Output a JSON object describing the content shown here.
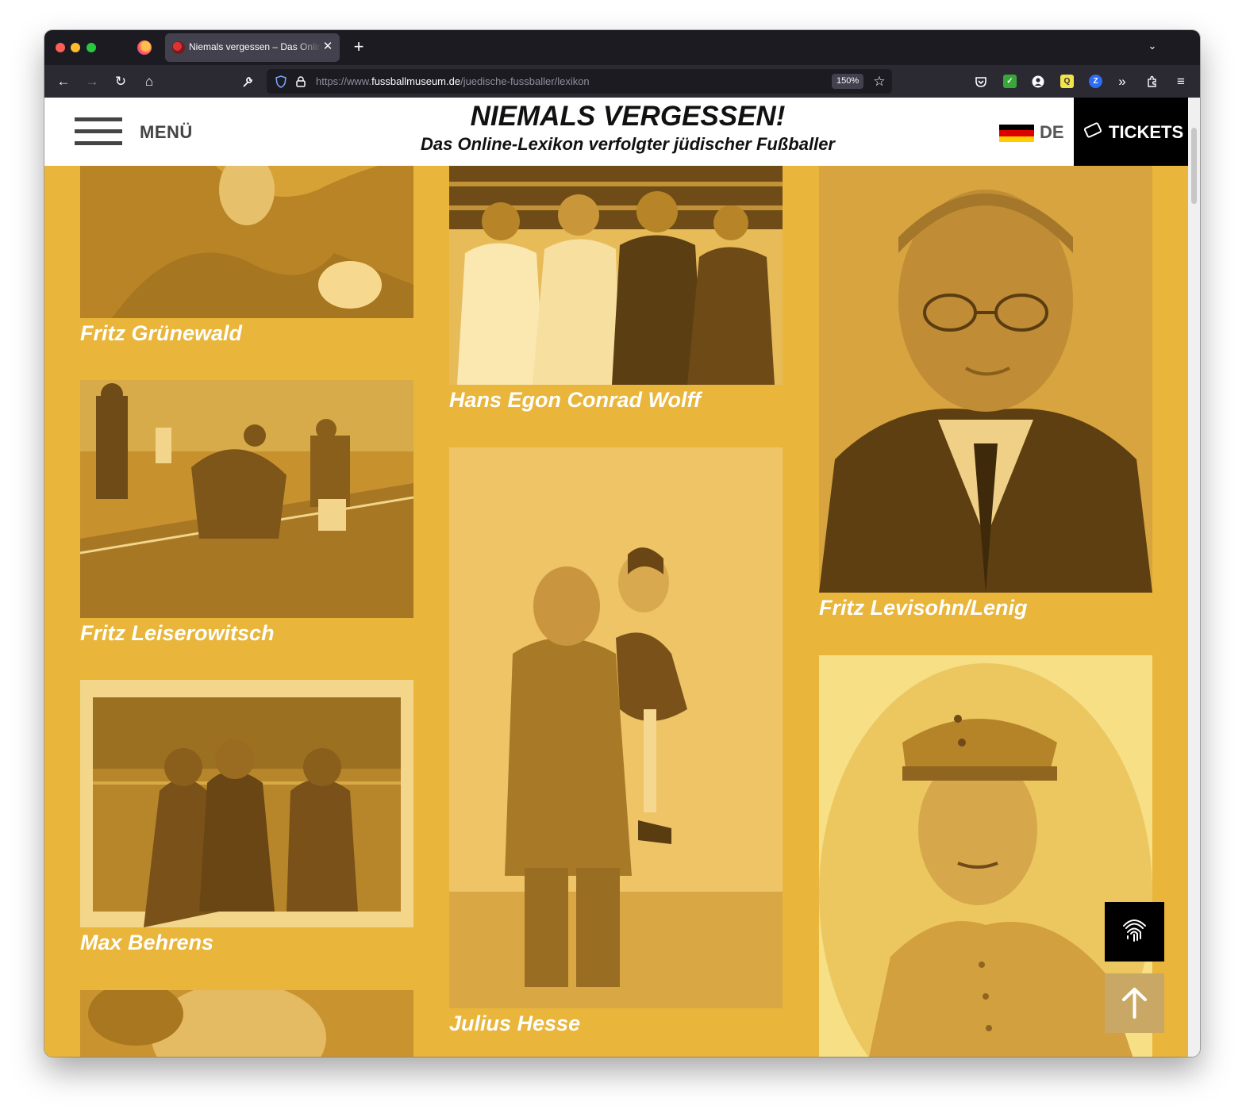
{
  "browser": {
    "tab_title": "Niemals vergessen – Das Online-Lexikon verfolgter jüdischer Fußballer",
    "url_prefix": "https://www.",
    "url_host": "fussballmuseum.de",
    "url_path": "/juedische-fussballer/lexikon",
    "zoom": "150%",
    "icons": [
      "back-icon",
      "forward-icon",
      "reload-icon",
      "home-icon",
      "wrench-icon",
      "shield-icon",
      "lock-icon",
      "bookmark-star-icon",
      "pocket-icon",
      "account-icon",
      "extensions-icon",
      "menu-icon"
    ]
  },
  "header": {
    "menu_label": "MENÜ",
    "title": "NIEMALS VERGESSEN!",
    "subtitle": "Das Online-Lexikon verfolgter jüdischer Fußballer",
    "language": "DE",
    "tickets_label": "TICKETS",
    "flag_colors": [
      "#000000",
      "#dd0000",
      "#ffce00"
    ]
  },
  "theme": {
    "background": "#e9b53a",
    "caption_color": "#ffffff"
  },
  "players": [
    {
      "name": "Fritz Grünewald"
    },
    {
      "name": "Fritz Leiserowitsch"
    },
    {
      "name": "Max Behrens"
    },
    {
      "name": "Hans Egon Conrad Wolff"
    },
    {
      "name": "Julius Hesse"
    },
    {
      "name": "Fritz Levisohn/Lenig"
    },
    {
      "name": ""
    }
  ],
  "floating": {
    "fingerprint_icon": "fingerprint-icon",
    "scroll_top_icon": "arrow-up-icon"
  }
}
